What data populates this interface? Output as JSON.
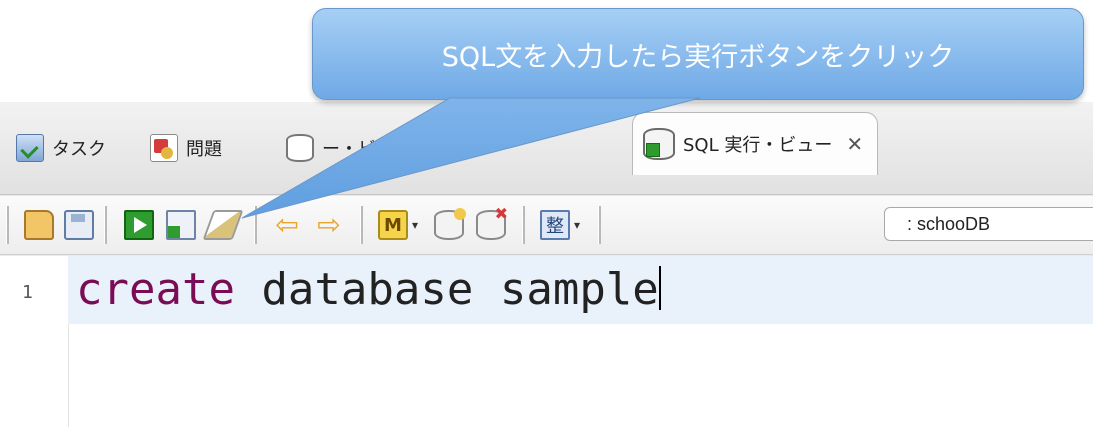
{
  "callout": {
    "text": "SQL文を入力したら実行ボタンをクリック"
  },
  "tabs": [
    {
      "label": "タスク",
      "icon": "task-icon"
    },
    {
      "label": "問題",
      "icon": "problem-icon"
    },
    {
      "label": "ー・ビュー",
      "icon": "database-icon"
    },
    {
      "label": "SQL 実行・ビュー",
      "icon": "sql-execute-icon",
      "active": true
    }
  ],
  "tab_close_glyph": "✕",
  "toolbar": {
    "connection_label": ": schooDB",
    "buttons": [
      "open-file-icon",
      "save-icon",
      "run-icon",
      "run-file-icon",
      "clear-icon",
      "back-arrow-icon",
      "forward-arrow-icon",
      "template-m-icon",
      "add-connection-icon",
      "remove-connection-icon",
      "format-icon"
    ],
    "back_glyph": "⇦",
    "forward_glyph": "⇨",
    "m_glyph": "M",
    "format_glyph": "整"
  },
  "editor": {
    "line_number": "1",
    "keyword": "create",
    "rest": " database sample"
  },
  "colors": {
    "callout_top": "#a6cff5",
    "callout_bottom": "#6fa9e6",
    "keyword": "#7a0b55",
    "current_line": "#e9f1fb",
    "run_green": "#2e9c2e"
  }
}
